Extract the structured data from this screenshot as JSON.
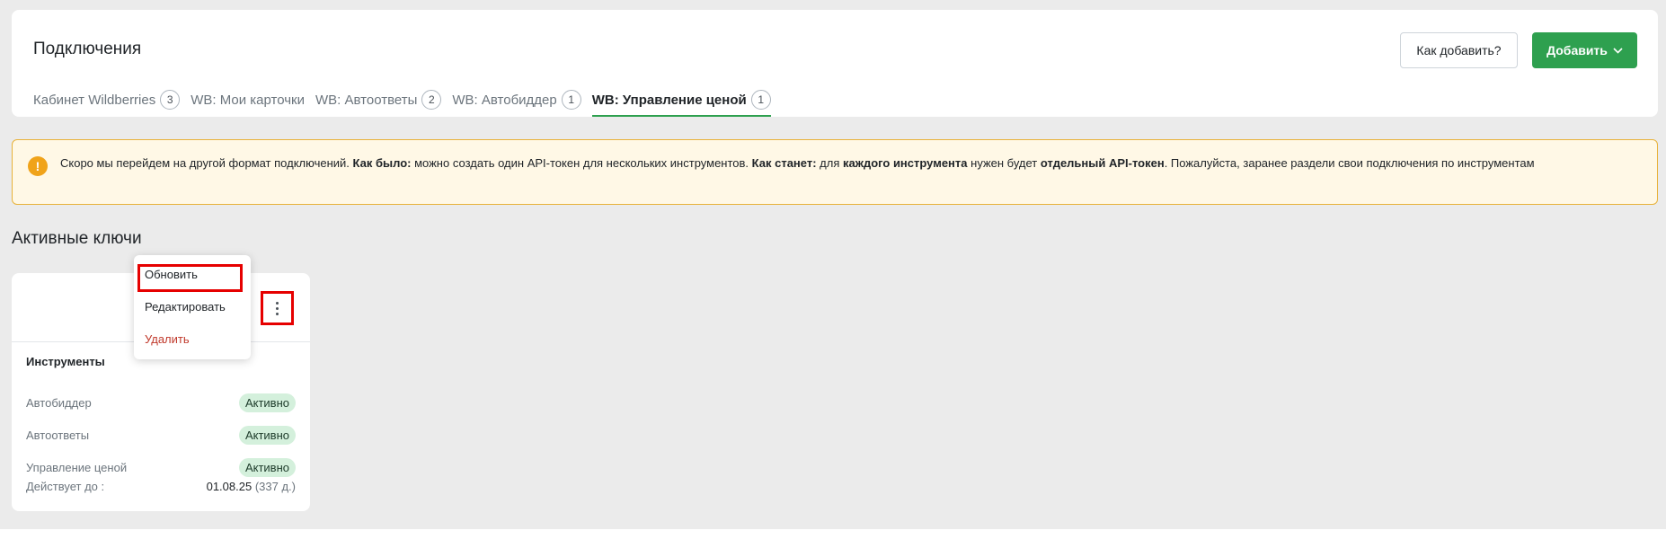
{
  "header": {
    "title": "Подключения",
    "how_to_add_label": "Как добавить?",
    "add_label": "Добавить"
  },
  "tabs": [
    {
      "label": "Кабинет Wildberries",
      "count": "3"
    },
    {
      "label": "WB: Мои карточки"
    },
    {
      "label": "WB: Автоответы",
      "count": "2"
    },
    {
      "label": "WB: Автобиддер",
      "count": "1"
    },
    {
      "label": "WB: Управление ценой",
      "count": "1",
      "active": true
    }
  ],
  "alert": {
    "icon": "!",
    "t1": "Скоро мы перейдем на другой формат подключений.",
    "b1": "Как было:",
    "t2": "можно создать один API-токен для нескольких инструментов.",
    "b2": "Как станет:",
    "t3": "для",
    "b3": "каждого инструмента",
    "t4": "нужен будет",
    "b4": "отдельный API-токен",
    "t5": ". Пожалуйста, заранее раздели свои подключения по инструментам"
  },
  "section_title": "Активные ключи",
  "card": {
    "tools_title": "Инструменты",
    "tools": [
      {
        "name": "Автобиддер",
        "status": "Активно"
      },
      {
        "name": "Автоответы",
        "status": "Активно"
      },
      {
        "name": "Управление ценой",
        "status": "Активно"
      }
    ],
    "valid_label": "Действует до :",
    "valid_date": "01.08.25",
    "valid_days": "(337 д.)"
  },
  "menu": {
    "refresh": "Обновить",
    "edit": "Редактировать",
    "delete": "Удалить"
  },
  "colors": {
    "accent_green": "#2ea04f",
    "alert_border": "#e8b23a",
    "danger": "#c0392b",
    "highlight": "#e60000"
  }
}
